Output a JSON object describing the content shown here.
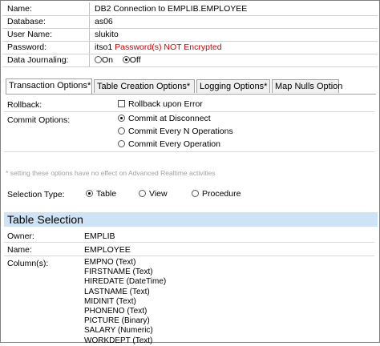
{
  "properties": [
    {
      "label": "Name:",
      "value": "DB2 Connection to EMPLIB.EMPLOYEE"
    },
    {
      "label": "Database:",
      "value": "as06"
    },
    {
      "label": "User Name:",
      "value": "slukito"
    },
    {
      "label": "Password:",
      "value": "itso1",
      "warning": "Password(s) NOT Encrypted"
    }
  ],
  "data_journaling": {
    "label": "Data Journaling:",
    "on": "On",
    "off": "Off",
    "selected": "Off"
  },
  "tabs": [
    "Transaction Options*",
    "Table Creation Options*",
    "Logging Options*",
    "Map Nulls Option"
  ],
  "transaction": {
    "rollback_label": "Rollback:",
    "rollback_option": "Rollback upon Error",
    "commit_label": "Commit Options:",
    "commit_options": [
      "Commit at Disconnect",
      "Commit Every N Operations",
      "Commit Every Operation"
    ],
    "commit_selected": "Commit at Disconnect"
  },
  "note": "* setting these options have no effect on Advanced Realtime activities",
  "selection_type": {
    "label": "Selection Type:",
    "options": [
      "Table",
      "View",
      "Procedure"
    ],
    "selected": "Table"
  },
  "table_selection": {
    "title": "Table Selection",
    "owner_label": "Owner:",
    "owner": "EMPLIB",
    "name_label": "Name:",
    "name": "EMPLOYEE",
    "columns_label": "Column(s):",
    "columns": [
      "EMPNO (Text)",
      "FIRSTNAME (Text)",
      "HIREDATE (DateTime)",
      "LASTNAME (Text)",
      "MIDINIT (Text)",
      "PHONENO (Text)",
      "PICTURE (Binary)",
      "SALARY (Numeric)",
      "WORKDEPT (Text)"
    ]
  },
  "colors": {
    "warning": "#cc0000",
    "section_bg": "#cfe3f7",
    "note": "#a0a0a0"
  }
}
